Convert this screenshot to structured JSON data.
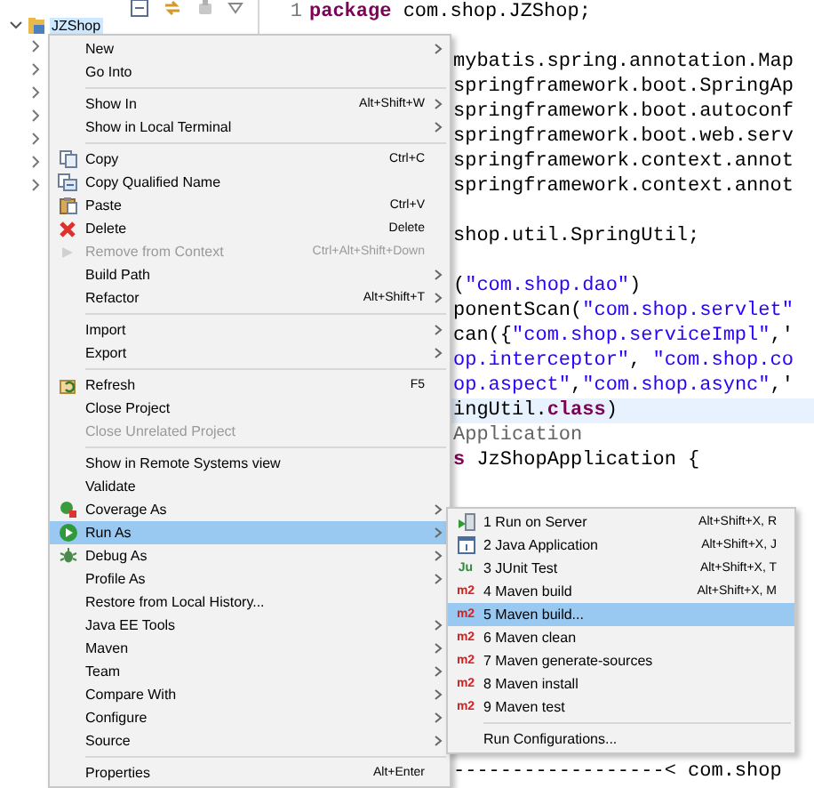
{
  "project_tree": {
    "root": {
      "label": "JZShop",
      "selected": true,
      "expanded": true
    },
    "children": [
      {
        "expanded": false
      },
      {
        "expanded": false
      },
      {
        "expanded": false
      },
      {
        "expanded": false
      },
      {
        "expanded": false
      },
      {
        "expanded": false
      },
      {
        "expanded": false
      }
    ]
  },
  "editor": {
    "lines": [
      {
        "number": "1",
        "kind": "full",
        "segments": [
          {
            "kind": "keyword",
            "text": "package"
          },
          {
            "kind": "plain",
            "text": " com.shop.JZShop;"
          }
        ]
      },
      {
        "kind": "empty"
      },
      {
        "kind": "clipped",
        "segments": [
          {
            "kind": "plain",
            "text": "mybatis.spring.annotation.Map"
          }
        ]
      },
      {
        "kind": "clipped",
        "segments": [
          {
            "kind": "plain",
            "text": "springframework.boot.SpringAp"
          }
        ]
      },
      {
        "kind": "clipped",
        "segments": [
          {
            "kind": "plain",
            "text": "springframework.boot.autoconf"
          }
        ]
      },
      {
        "kind": "clipped",
        "segments": [
          {
            "kind": "plain",
            "text": "springframework.boot.web.serv"
          }
        ]
      },
      {
        "kind": "clipped",
        "segments": [
          {
            "kind": "plain",
            "text": "springframework.context.annot"
          }
        ]
      },
      {
        "kind": "clipped",
        "segments": [
          {
            "kind": "plain",
            "text": "springframework.context.annot"
          }
        ]
      },
      {
        "kind": "empty"
      },
      {
        "kind": "clipped",
        "segments": [
          {
            "kind": "plain",
            "text": "shop.util.SpringUtil;"
          }
        ]
      },
      {
        "kind": "empty"
      },
      {
        "kind": "clipped",
        "segments": [
          {
            "kind": "plain",
            "text": "("
          },
          {
            "kind": "string",
            "text": "\"com.shop.dao\""
          },
          {
            "kind": "plain",
            "text": ")"
          }
        ]
      },
      {
        "kind": "clipped",
        "segments": [
          {
            "kind": "plain",
            "text": "ponentScan("
          },
          {
            "kind": "string",
            "text": "\"com.shop.servlet\""
          }
        ]
      },
      {
        "kind": "clipped",
        "segments": [
          {
            "kind": "plain",
            "text": "can({"
          },
          {
            "kind": "string",
            "text": "\"com.shop.serviceImpl\""
          },
          {
            "kind": "plain",
            "text": ",'"
          }
        ]
      },
      {
        "kind": "clipped",
        "segments": [
          {
            "kind": "string",
            "text": "op.interceptor\""
          },
          {
            "kind": "plain",
            "text": ", "
          },
          {
            "kind": "string",
            "text": "\"com.shop.co"
          }
        ]
      },
      {
        "kind": "clipped",
        "segments": [
          {
            "kind": "string",
            "text": "op.aspect\""
          },
          {
            "kind": "plain",
            "text": ","
          },
          {
            "kind": "string",
            "text": "\"com.shop.async\""
          },
          {
            "kind": "plain",
            "text": ",'"
          }
        ]
      },
      {
        "kind": "clipped",
        "highlighted": true,
        "segments": [
          {
            "kind": "plain",
            "text": "ingUtil."
          },
          {
            "kind": "keyword",
            "text": "class"
          },
          {
            "kind": "plain",
            "text": ")"
          }
        ]
      },
      {
        "kind": "clipped",
        "segments": [
          {
            "kind": "annotation",
            "text": "Application"
          }
        ]
      },
      {
        "kind": "clipped",
        "segments": [
          {
            "kind": "keyword",
            "text": "s"
          },
          {
            "kind": "plain",
            "text": " JzShopApplication {"
          }
        ]
      },
      {
        "kind": "empty"
      },
      {
        "kind": "empty"
      },
      {
        "kind": "empty"
      },
      {
        "kind": "empty"
      },
      {
        "kind": "empty"
      },
      {
        "kind": "empty"
      },
      {
        "kind": "empty"
      },
      {
        "kind": "empty"
      },
      {
        "kind": "empty"
      },
      {
        "kind": "empty"
      },
      {
        "kind": "empty"
      },
      {
        "kind": "console",
        "segments": [
          {
            "kind": "plain",
            "text": "------------------< com.shop"
          }
        ]
      }
    ]
  },
  "context_menu": {
    "items": [
      {
        "kind": "item",
        "label": "New",
        "submenu": true,
        "disabled": false,
        "selected": false
      },
      {
        "kind": "item",
        "label": "Go Into",
        "submenu": false,
        "disabled": false,
        "selected": false
      },
      {
        "kind": "separator"
      },
      {
        "kind": "item",
        "label": "Show In",
        "shortcut": "Alt+Shift+W",
        "submenu": true,
        "disabled": false,
        "selected": false
      },
      {
        "kind": "item",
        "label": "Show in Local Terminal",
        "submenu": true,
        "disabled": false,
        "selected": false
      },
      {
        "kind": "separator"
      },
      {
        "kind": "item",
        "label": "Copy",
        "shortcut": "Ctrl+C",
        "submenu": false,
        "disabled": false,
        "selected": false
      },
      {
        "kind": "item",
        "label": "Copy Qualified Name",
        "submenu": false,
        "disabled": false,
        "selected": false
      },
      {
        "kind": "item",
        "label": "Paste",
        "shortcut": "Ctrl+V",
        "submenu": false,
        "disabled": false,
        "selected": false
      },
      {
        "kind": "item",
        "label": "Delete",
        "shortcut": "Delete",
        "submenu": false,
        "disabled": false,
        "selected": false
      },
      {
        "kind": "item",
        "label": "Remove from Context",
        "shortcut": "Ctrl+Alt+Shift+Down",
        "submenu": false,
        "disabled": true,
        "selected": false
      },
      {
        "kind": "item",
        "label": "Build Path",
        "submenu": true,
        "disabled": false,
        "selected": false
      },
      {
        "kind": "item",
        "label": "Refactor",
        "shortcut": "Alt+Shift+T",
        "submenu": true,
        "disabled": false,
        "selected": false
      },
      {
        "kind": "separator"
      },
      {
        "kind": "item",
        "label": "Import",
        "submenu": true,
        "disabled": false,
        "selected": false
      },
      {
        "kind": "item",
        "label": "Export",
        "submenu": true,
        "disabled": false,
        "selected": false
      },
      {
        "kind": "separator"
      },
      {
        "kind": "item",
        "label": "Refresh",
        "shortcut": "F5",
        "submenu": false,
        "disabled": false,
        "selected": false
      },
      {
        "kind": "item",
        "label": "Close Project",
        "submenu": false,
        "disabled": false,
        "selected": false
      },
      {
        "kind": "item",
        "label": "Close Unrelated Project",
        "submenu": false,
        "disabled": true,
        "selected": false
      },
      {
        "kind": "separator"
      },
      {
        "kind": "item",
        "label": "Show in Remote Systems view",
        "submenu": false,
        "disabled": false,
        "selected": false
      },
      {
        "kind": "item",
        "label": "Validate",
        "submenu": false,
        "disabled": false,
        "selected": false
      },
      {
        "kind": "item",
        "label": "Coverage As",
        "submenu": true,
        "disabled": false,
        "selected": false
      },
      {
        "kind": "item",
        "label": "Run As",
        "submenu": true,
        "disabled": false,
        "selected": true
      },
      {
        "kind": "item",
        "label": "Debug As",
        "submenu": true,
        "disabled": false,
        "selected": false
      },
      {
        "kind": "item",
        "label": "Profile As",
        "submenu": true,
        "disabled": false,
        "selected": false
      },
      {
        "kind": "item",
        "label": "Restore from Local History...",
        "submenu": false,
        "disabled": false,
        "selected": false
      },
      {
        "kind": "item",
        "label": "Java EE Tools",
        "submenu": true,
        "disabled": false,
        "selected": false
      },
      {
        "kind": "item",
        "label": "Maven",
        "submenu": true,
        "disabled": false,
        "selected": false
      },
      {
        "kind": "item",
        "label": "Team",
        "submenu": true,
        "disabled": false,
        "selected": false
      },
      {
        "kind": "item",
        "label": "Compare With",
        "submenu": true,
        "disabled": false,
        "selected": false
      },
      {
        "kind": "item",
        "label": "Configure",
        "submenu": true,
        "disabled": false,
        "selected": false
      },
      {
        "kind": "item",
        "label": "Source",
        "submenu": true,
        "disabled": false,
        "selected": false
      },
      {
        "kind": "separator"
      },
      {
        "kind": "item",
        "label": "Properties",
        "shortcut": "Alt+Enter",
        "submenu": false,
        "disabled": false,
        "selected": false
      }
    ]
  },
  "run_as_submenu": {
    "items": [
      {
        "kind": "item",
        "label": "1 Run on Server",
        "shortcut": "Alt+Shift+X, R",
        "selected": false
      },
      {
        "kind": "item",
        "label": "2 Java Application",
        "shortcut": "Alt+Shift+X, J",
        "selected": false
      },
      {
        "kind": "item",
        "label": "3 JUnit Test",
        "shortcut": "Alt+Shift+X, T",
        "badge": "Ju",
        "selected": false
      },
      {
        "kind": "item",
        "label": "4 Maven build",
        "shortcut": "Alt+Shift+X, M",
        "badge": "m2",
        "selected": false
      },
      {
        "kind": "item",
        "label": "5 Maven build...",
        "badge": "m2",
        "selected": true
      },
      {
        "kind": "item",
        "label": "6 Maven clean",
        "badge": "m2",
        "selected": false
      },
      {
        "kind": "item",
        "label": "7 Maven generate-sources",
        "badge": "m2",
        "selected": false
      },
      {
        "kind": "item",
        "label": "8 Maven install",
        "badge": "m2",
        "selected": false
      },
      {
        "kind": "item",
        "label": "9 Maven test",
        "badge": "m2",
        "selected": false
      },
      {
        "kind": "separator"
      },
      {
        "kind": "item",
        "label": "Run Configurations...",
        "selected": false
      }
    ]
  }
}
